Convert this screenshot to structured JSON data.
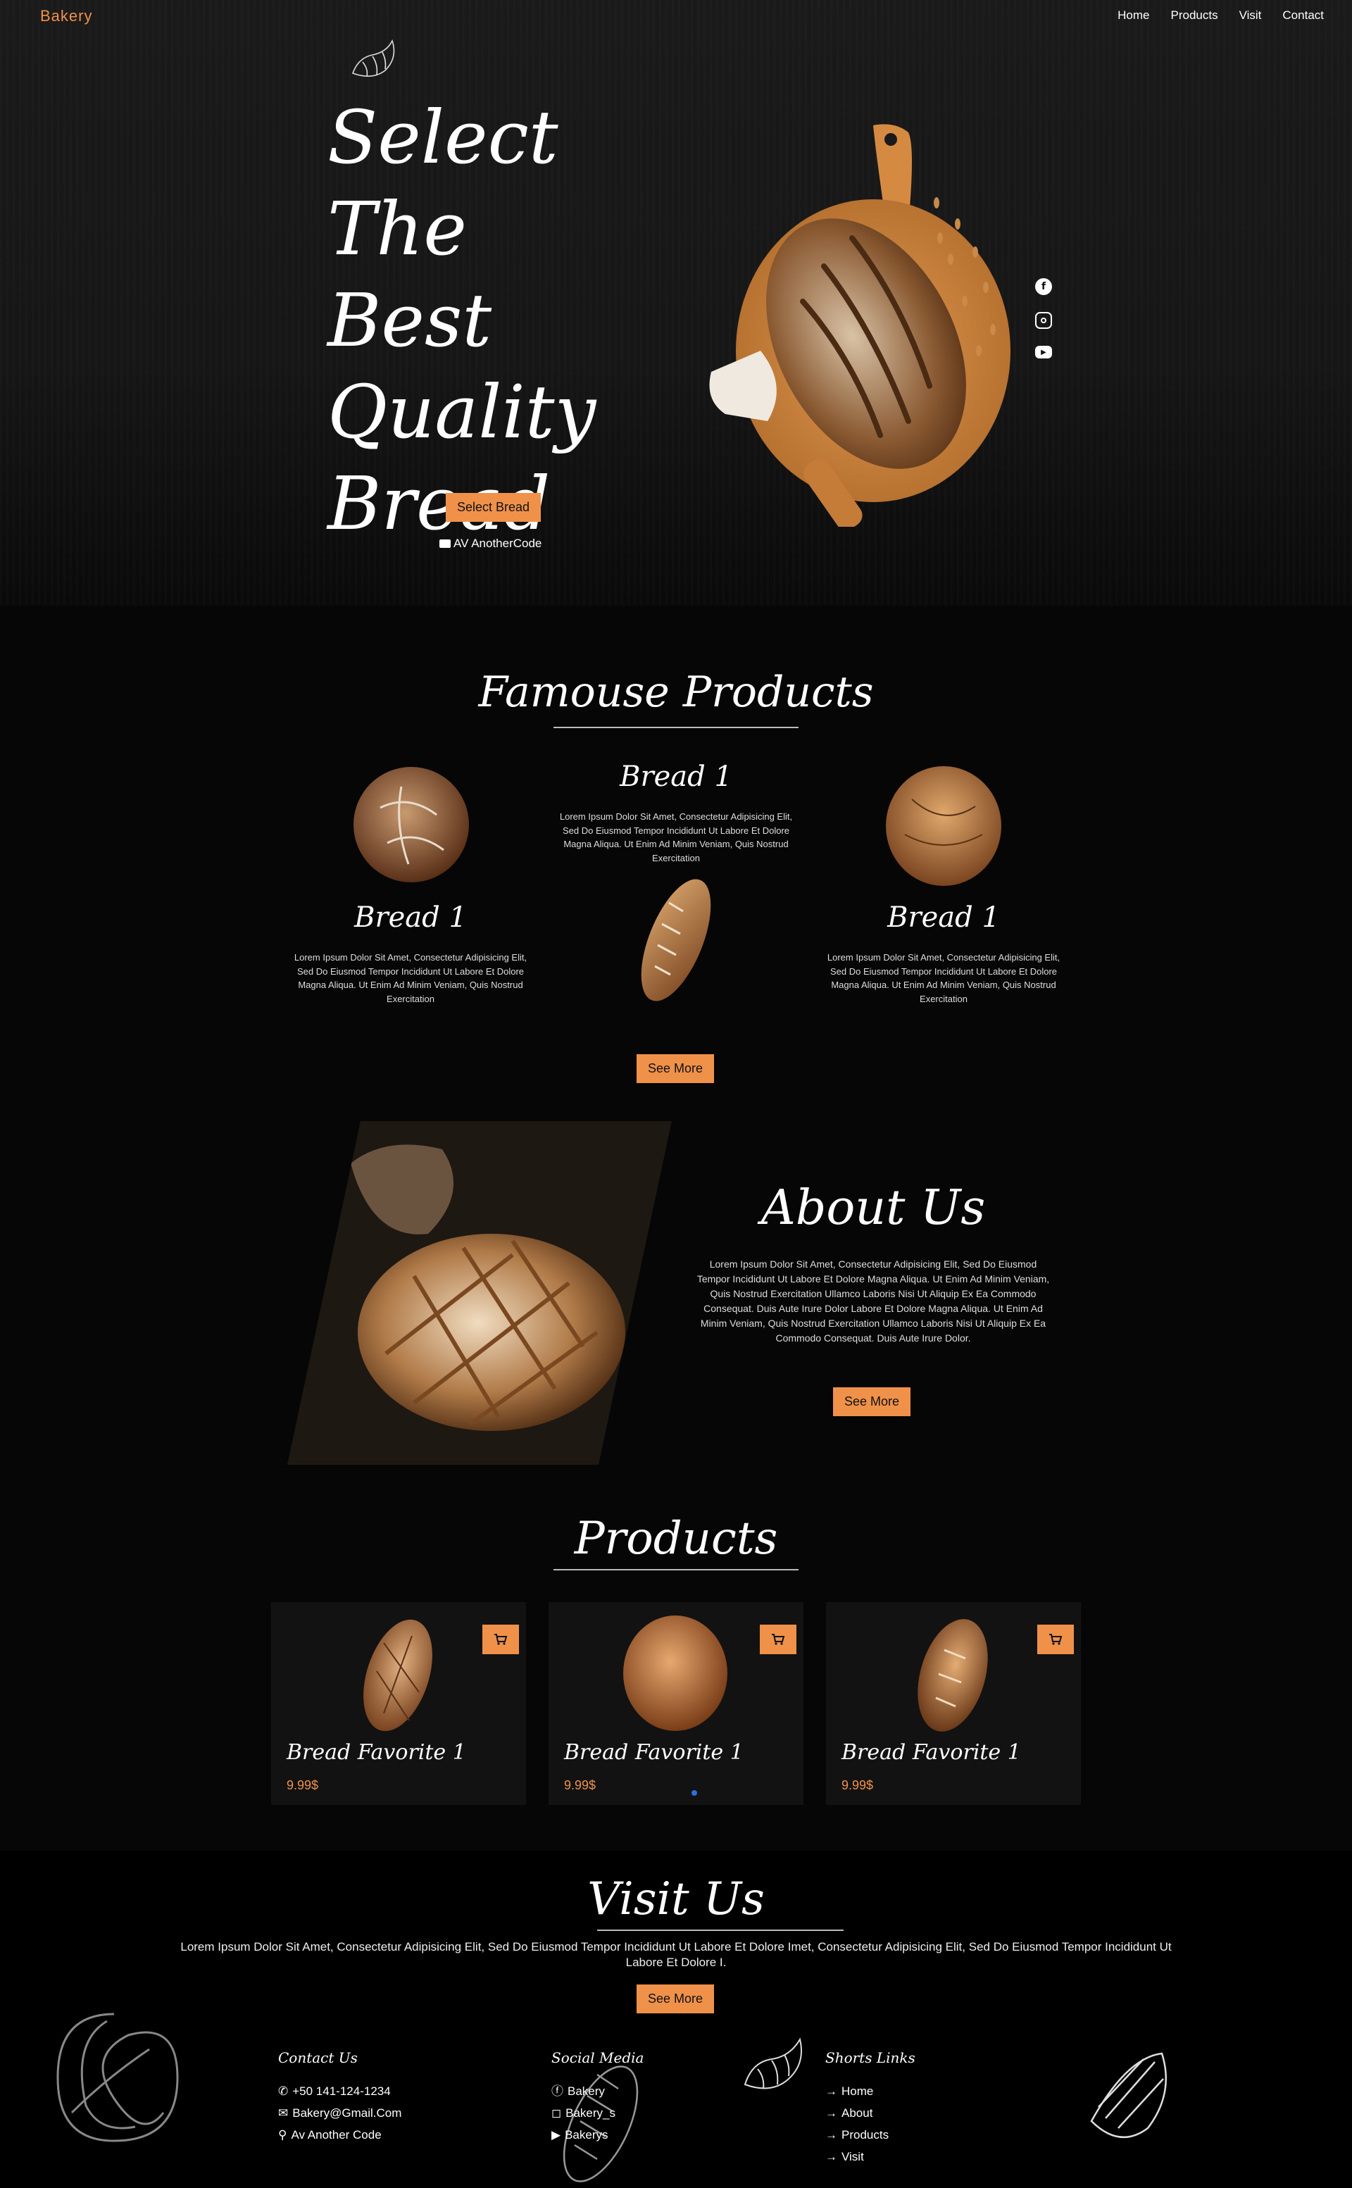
{
  "nav": {
    "logo": "Bakery",
    "items": [
      "Home",
      "Products",
      "Visit",
      "Contact"
    ]
  },
  "hero": {
    "title_lines": [
      "Select The",
      "Best",
      "Quality",
      "Bread"
    ],
    "button": "Select Bread",
    "credit": "AV AnotherCode",
    "social_icons": [
      "facebook-icon",
      "instagram-icon",
      "youtube-icon"
    ]
  },
  "famous": {
    "title": "Famouse Products",
    "products": [
      {
        "name": "Bread 1",
        "desc": "Lorem Ipsum Dolor Sit Amet, Consectetur Adipisicing Elit, Sed Do Eiusmod Tempor Incididunt Ut Labore Et Dolore Magna Aliqua. Ut Enim Ad Minim Veniam, Quis Nostrud Exercitation"
      },
      {
        "name": "Bread 1",
        "desc": "Lorem Ipsum Dolor Sit Amet, Consectetur Adipisicing Elit, Sed Do Eiusmod Tempor Incididunt Ut Labore Et Dolore Magna Aliqua. Ut Enim Ad Minim Veniam, Quis Nostrud Exercitation"
      },
      {
        "name": "Bread 1",
        "desc": "Lorem Ipsum Dolor Sit Amet, Consectetur Adipisicing Elit, Sed Do Eiusmod Tempor Incididunt Ut Labore Et Dolore Magna Aliqua. Ut Enim Ad Minim Veniam, Quis Nostrud Exercitation"
      }
    ],
    "button": "See More"
  },
  "about": {
    "title": "About Us",
    "text": "Lorem Ipsum Dolor Sit Amet, Consectetur Adipisicing Elit, Sed Do Eiusmod Tempor Incididunt Ut Labore Et Dolore Magna Aliqua. Ut Enim Ad Minim Veniam, Quis Nostrud Exercitation Ullamco Laboris Nisi Ut Aliquip Ex Ea Commodo Consequat. Duis Aute Irure Dolor Labore Et Dolore Magna Aliqua. Ut Enim Ad Minim Veniam, Quis Nostrud Exercitation Ullamco Laboris Nisi Ut Aliquip Ex Ea Commodo Consequat. Duis Aute Irure Dolor.",
    "button": "See More"
  },
  "products": {
    "title": "Products",
    "items": [
      {
        "name": "Bread Favorite 1",
        "price": "9.99$"
      },
      {
        "name": "Bread Favorite 1",
        "price": "9.99$"
      },
      {
        "name": "Bread Favorite 1",
        "price": "9.99$"
      }
    ]
  },
  "visit": {
    "title": "Visit Us",
    "text": "Lorem Ipsum Dolor Sit Amet, Consectetur Adipisicing Elit, Sed Do Eiusmod Tempor Incididunt Ut Labore Et Dolore Imet, Consectetur Adipisicing Elit, Sed Do Eiusmod Tempor Incididunt Ut Labore Et Dolore I.",
    "button": "See More"
  },
  "footer": {
    "contact": {
      "title": "Contact Us",
      "phone": "+50 141-124-1234",
      "email": "Bakery@Gmail.Com",
      "address": "Av Another Code"
    },
    "social": {
      "title": "Social Media",
      "items": [
        "Bakery",
        "Bakery_s",
        "Bakerys"
      ]
    },
    "links": {
      "title": "Shorts Links",
      "items": [
        "Home",
        "About",
        "Products",
        "Visit"
      ]
    }
  },
  "colors": {
    "accent": "#f0914a",
    "background": "#060606",
    "card": "#121212"
  }
}
